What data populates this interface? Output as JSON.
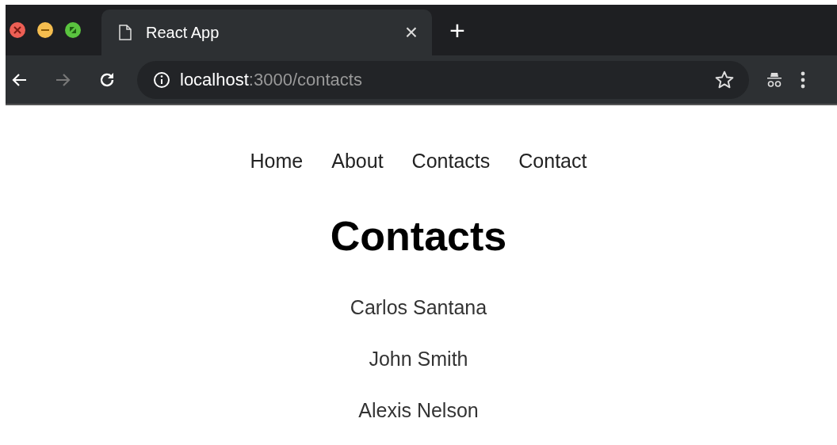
{
  "browser": {
    "tab": {
      "title": "React App",
      "close": "×"
    },
    "new_tab": "+",
    "url": {
      "host": "localhost",
      "path": ":3000/contacts"
    }
  },
  "nav": [
    "Home",
    "About",
    "Contacts",
    "Contact"
  ],
  "heading": "Contacts",
  "contacts": [
    "Carlos Santana",
    "John Smith",
    "Alexis Nelson"
  ]
}
